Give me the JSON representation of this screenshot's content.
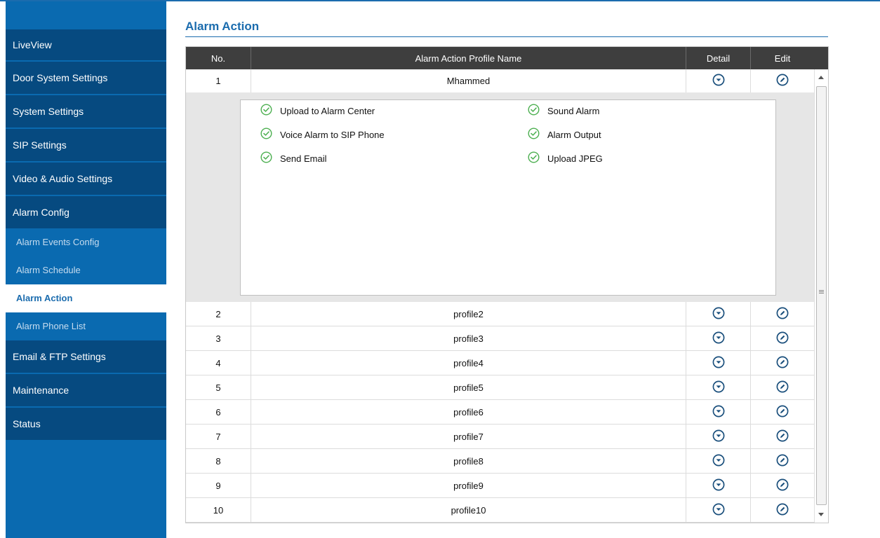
{
  "sidebar": {
    "items": [
      {
        "label": "LiveView"
      },
      {
        "label": "Door System Settings"
      },
      {
        "label": "System Settings"
      },
      {
        "label": "SIP Settings"
      },
      {
        "label": "Video & Audio Settings"
      },
      {
        "label": "Alarm Config"
      }
    ],
    "subitems": [
      {
        "label": "Alarm Events Config"
      },
      {
        "label": "Alarm Schedule"
      },
      {
        "label": "Alarm Action",
        "active": true
      },
      {
        "label": "Alarm Phone List"
      }
    ],
    "items_after": [
      {
        "label": "Email & FTP Settings"
      },
      {
        "label": "Maintenance"
      },
      {
        "label": "Status"
      }
    ]
  },
  "page": {
    "title": "Alarm Action"
  },
  "table": {
    "headers": {
      "no": "No.",
      "name": "Alarm Action Profile Name",
      "detail": "Detail",
      "edit": "Edit"
    },
    "rows": [
      {
        "no": "1",
        "name": "Mhammed"
      },
      {
        "no": "2",
        "name": "profile2"
      },
      {
        "no": "3",
        "name": "profile3"
      },
      {
        "no": "4",
        "name": "profile4"
      },
      {
        "no": "5",
        "name": "profile5"
      },
      {
        "no": "6",
        "name": "profile6"
      },
      {
        "no": "7",
        "name": "profile7"
      },
      {
        "no": "8",
        "name": "profile8"
      },
      {
        "no": "9",
        "name": "profile9"
      },
      {
        "no": "10",
        "name": "profile10"
      }
    ],
    "expanded_actions": [
      "Upload to Alarm Center",
      "Voice Alarm to SIP Phone",
      "Send Email",
      "Sound Alarm",
      "Alarm Output",
      "Upload JPEG"
    ]
  },
  "icons": {
    "detail": "chevron-down-circle-icon",
    "edit": "pencil-circle-icon",
    "action": "check-circle-icon"
  },
  "colors": {
    "accent": "#1b6cae",
    "sidebar_bg": "#0a6ab0",
    "nav_item_bg": "#064a80",
    "header_bg": "#3e3e3e",
    "check_green": "#4caf50",
    "expand_bg": "#e6e6e6"
  }
}
